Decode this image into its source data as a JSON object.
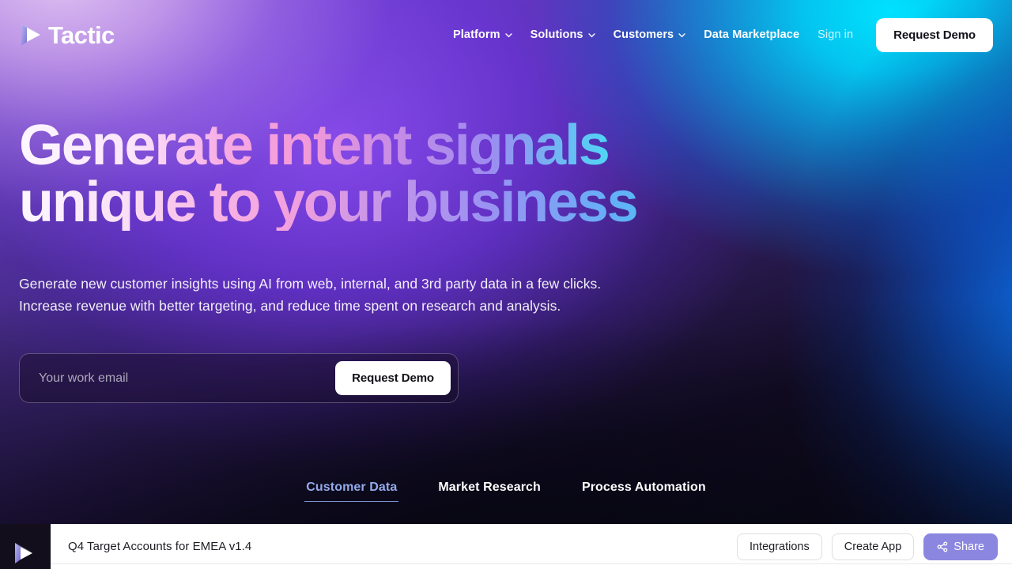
{
  "brand": {
    "name": "Tactic",
    "logo_icon": "play-triangle-icon"
  },
  "nav": {
    "items": [
      {
        "label": "Platform",
        "has_dropdown": true,
        "icon": "chevron-down-icon"
      },
      {
        "label": "Solutions",
        "has_dropdown": true,
        "icon": "chevron-down-icon"
      },
      {
        "label": "Customers",
        "has_dropdown": true,
        "icon": "chevron-down-icon"
      },
      {
        "label": "Data Marketplace",
        "has_dropdown": false
      }
    ],
    "sign_in_label": "Sign in",
    "cta_label": "Request Demo"
  },
  "hero": {
    "headline_line1": "Generate intent signals",
    "headline_line2": "unique to your business",
    "subtext_line1": "Generate new customer insights using AI from web, internal, and 3rd party data in a few clicks.",
    "subtext_line2": "Increase revenue with better targeting, and reduce time spent on research and analysis.",
    "email_placeholder": "Your work email",
    "email_value": "",
    "form_cta_label": "Request Demo"
  },
  "tabs": [
    {
      "label": "Customer Data",
      "active": true
    },
    {
      "label": "Market Research",
      "active": false
    },
    {
      "label": "Process Automation",
      "active": false
    }
  ],
  "app_preview": {
    "document_title": "Q4 Target Accounts for EMEA v1.4",
    "sidebar_logo_icon": "play-triangle-icon",
    "buttons": [
      {
        "label": "Integrations",
        "style": "outline"
      },
      {
        "label": "Create App",
        "style": "outline"
      }
    ],
    "share_label": "Share",
    "share_icon": "share-nodes-icon"
  },
  "colors": {
    "lavender": "#cda6ec",
    "violet": "#894af0",
    "cyan": "#00e2ff",
    "blue": "#0c70e8",
    "dark_purple": "#140d26",
    "active_tab": "#93aaea",
    "share_purple": "#8b87e0",
    "cta_white": "#ffffff"
  }
}
